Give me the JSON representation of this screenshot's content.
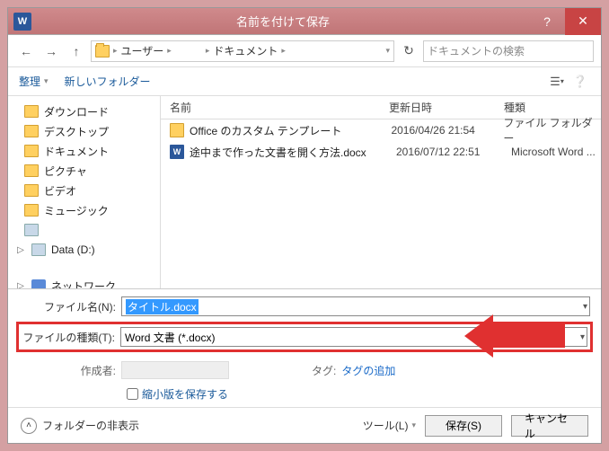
{
  "title": "名前を付けて保存",
  "addr": {
    "root": "ユーザー",
    "folder": "ドキュメント"
  },
  "search_placeholder": "ドキュメントの検索",
  "toolbar": {
    "organize": "整理",
    "newfolder": "新しいフォルダー"
  },
  "tree": [
    {
      "label": "ダウンロード"
    },
    {
      "label": "デスクトップ"
    },
    {
      "label": "ドキュメント"
    },
    {
      "label": "ピクチャ"
    },
    {
      "label": "ビデオ"
    },
    {
      "label": "ミュージック"
    }
  ],
  "drive": "Data (D:)",
  "network": "ネットワーク",
  "cols": {
    "name": "名前",
    "date": "更新日時",
    "type": "種類"
  },
  "files": [
    {
      "name": "Office のカスタム テンプレート",
      "date": "2016/04/26 21:54",
      "type": "ファイル フォルダー",
      "kind": "folder"
    },
    {
      "name": "途中まで作った文書を開く方法.docx",
      "date": "2016/07/12 22:51",
      "type": "Microsoft Word ...",
      "kind": "word"
    }
  ],
  "form": {
    "filename_label": "ファイル名(N):",
    "filename_value": "タイトル.docx",
    "filetype_label": "ファイルの種類(T):",
    "filetype_value": "Word 文書 (*.docx)",
    "author_label": "作成者:",
    "tag_label": "タグ:",
    "tag_value": "タグの追加",
    "thumb_checkbox": "縮小版を保存する"
  },
  "footer": {
    "hide_folders": "フォルダーの非表示",
    "tools": "ツール(L)",
    "save": "保存(S)",
    "cancel": "キャンセル"
  }
}
